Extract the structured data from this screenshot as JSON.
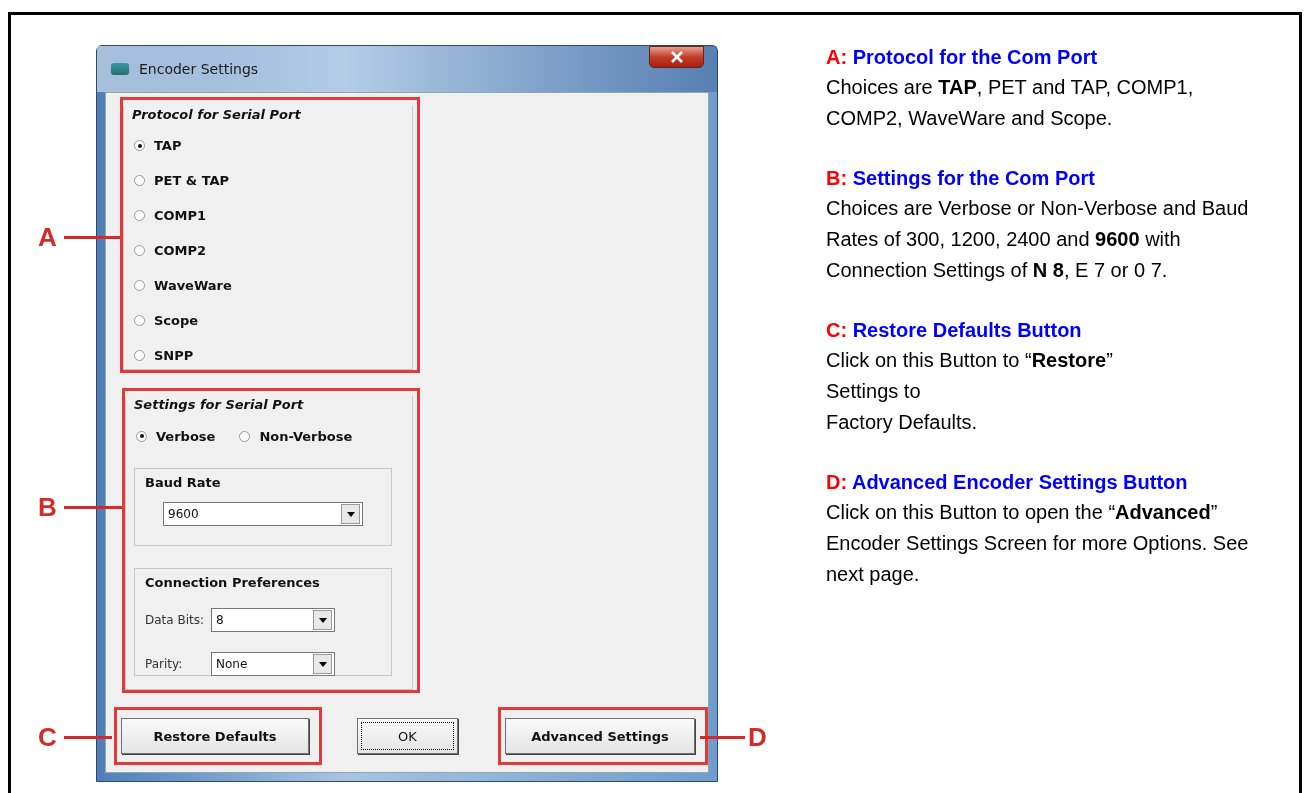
{
  "dialog": {
    "title": "Encoder Settings",
    "protocol_group": {
      "label": "Protocol for Serial Port",
      "options": [
        {
          "label": "TAP",
          "selected": true
        },
        {
          "label": "PET & TAP",
          "selected": false
        },
        {
          "label": "COMP1",
          "selected": false
        },
        {
          "label": "COMP2",
          "selected": false
        },
        {
          "label": "WaveWare",
          "selected": false
        },
        {
          "label": "Scope",
          "selected": false
        },
        {
          "label": "SNPP",
          "selected": false
        }
      ]
    },
    "settings_group": {
      "label": "Settings for Serial Port",
      "modes": [
        {
          "label": "Verbose",
          "selected": true
        },
        {
          "label": "Non-Verbose",
          "selected": false
        }
      ],
      "baud_rate": {
        "label": "Baud Rate",
        "value": "9600"
      },
      "connection": {
        "label": "Connection Preferences",
        "fields": [
          {
            "label": "Data Bits:",
            "value": "8"
          },
          {
            "label": "Parity:",
            "value": "None"
          }
        ]
      }
    },
    "buttons": [
      {
        "label": "Restore Defaults",
        "focused": false
      },
      {
        "label": "OK",
        "focused": true
      },
      {
        "label": "Advanced Settings",
        "focused": false
      }
    ]
  },
  "callouts": [
    {
      "letter": "A"
    },
    {
      "letter": "B"
    },
    {
      "letter": "C"
    },
    {
      "letter": "D"
    }
  ],
  "notes": [
    {
      "letter": "A:",
      "title": "Protocol for the Com Port",
      "body": "Choices are **TAP**, PET and TAP, COMP1, COMP2, WaveWare and Scope."
    },
    {
      "letter": "B:",
      "title": "Settings for the Com Port",
      "body": "Choices are Verbose or Non-Verbose and Baud Rates of 300, 1200, 2400 and **9600** with Connection Settings of **N 8**, E 7 or 0 7."
    },
    {
      "letter": "C:",
      "title": "Restore Defaults Button",
      "body": "Click on this Button to “**Restore**”\nSettings to\nFactory Defaults."
    },
    {
      "letter": "D:",
      "title": "Advanced Encoder Settings Button",
      "body": "Click on this Button to open the “**Advanced**” Encoder Settings Screen for more Options. See next page."
    }
  ]
}
